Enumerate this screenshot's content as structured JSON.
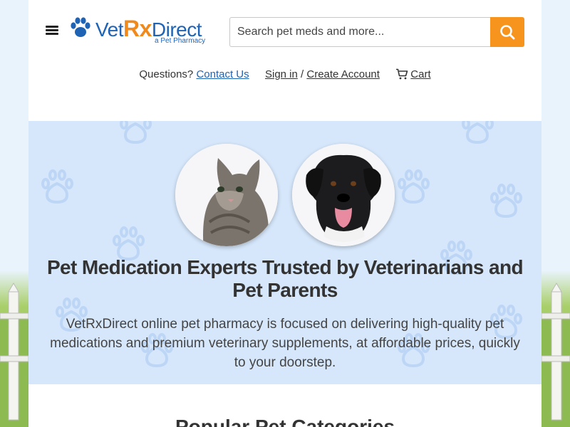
{
  "header": {
    "logo": {
      "brand_a": "Vet",
      "brand_rx": "Rx",
      "brand_b": "Direct",
      "tagline": "a Pet Pharmacy"
    },
    "search": {
      "placeholder": "Search pet meds and more..."
    },
    "links": {
      "questions": "Questions?",
      "contact": "Contact Us",
      "signin": "Sign in",
      "separator": "/",
      "create_account": "Create Account",
      "cart": "Cart"
    }
  },
  "hero": {
    "title": "Pet Medication Experts Trusted by Veterinarians and Pet Parents",
    "description": "VetRxDirect online pet pharmacy is focused on delivering high-quality pet medications and premium veterinary supplements, at affordable prices, quickly to your doorstep."
  },
  "categories": {
    "title": "Popular Pet Categories"
  },
  "colors": {
    "brand_blue": "#1f63b5",
    "accent_orange": "#f7941d",
    "hero_bg": "#d6e7fb"
  },
  "icons": [
    "menu-icon",
    "paw-logo-icon",
    "search-icon",
    "cart-icon"
  ]
}
